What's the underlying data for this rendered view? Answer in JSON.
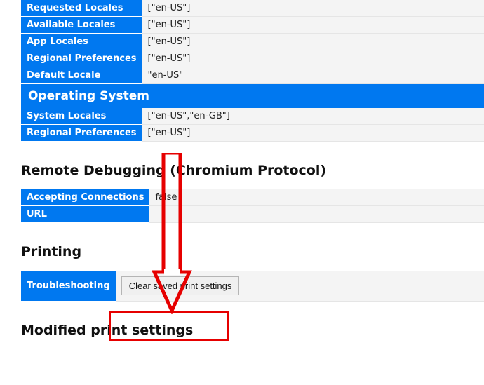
{
  "locale_section": {
    "requested_locales": {
      "label": "Requested Locales",
      "value": "[\"en-US\"]"
    },
    "available_locales": {
      "label": "Available Locales",
      "value": "[\"en-US\"]"
    },
    "app_locales": {
      "label": "App Locales",
      "value": "[\"en-US\"]"
    },
    "regional_prefs": {
      "label": "Regional Preferences",
      "value": "[\"en-US\"]"
    },
    "default_locale": {
      "label": "Default Locale",
      "value": "\"en-US\""
    }
  },
  "os_section": {
    "header": "Operating System",
    "system_locales": {
      "label": "System Locales",
      "value": "[\"en-US\",\"en-GB\"]"
    },
    "regional_prefs": {
      "label": "Regional Preferences",
      "value": "[\"en-US\"]"
    }
  },
  "remote_debug_section": {
    "header": "Remote Debugging (Chromium Protocol)",
    "accepting": {
      "label": "Accepting Connections",
      "value": "false"
    },
    "url": {
      "label": "URL",
      "value": ""
    }
  },
  "printing_section": {
    "header": "Printing",
    "troubleshooting_label": "Troubleshooting",
    "clear_button": "Clear saved print settings"
  },
  "modified_section": {
    "header": "Modified print settings"
  },
  "annotation": {
    "color": "#e60000"
  }
}
